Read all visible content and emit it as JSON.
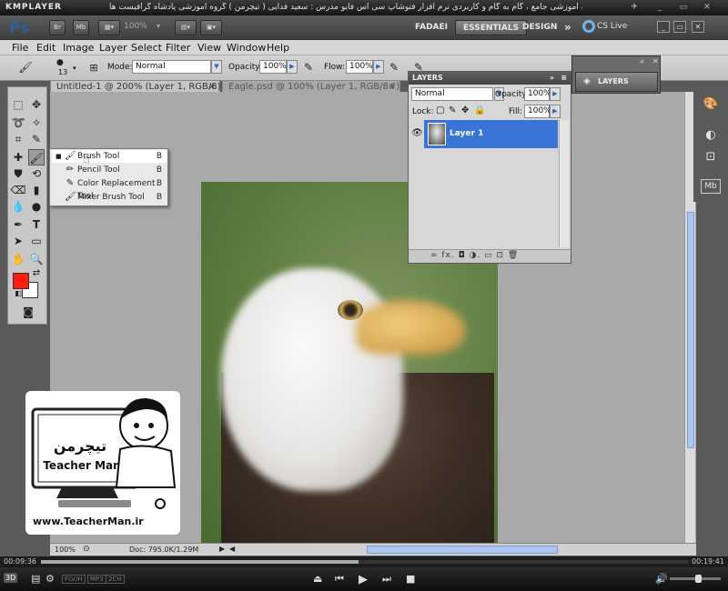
{
  "kmplayer": {
    "logo": "KMPLAYER",
    "title": "مجموعه آموزشی جامع ، گام به گام و کاربردی نرم افزار فتوشاپ سی اس فایو  مدرس : سعید فدایی ( تیچرمن ) گروه آموزشی پادشاه گرافیست ها",
    "time_elapsed": "00:09:36",
    "time_total": "00:19:41",
    "progress": 0.49,
    "badges": [
      "FLV/H",
      "MP3",
      "2CH"
    ],
    "mode_3d": "3D"
  },
  "appbar": {
    "ps_logo": "Ps",
    "br_label": "Br",
    "mb_label": "Mb",
    "zoom": "100%",
    "workspaces": [
      "FADAEI",
      "ESSENTIALS",
      "DESIGN"
    ],
    "more": "»",
    "cslive": "CS Live"
  },
  "menu": [
    "File",
    "Edit",
    "Image",
    "Layer",
    "Select",
    "Filter",
    "View",
    "Window",
    "Help"
  ],
  "options": {
    "brush_size": "13",
    "mode_label": "Mode:",
    "mode_value": "Normal",
    "opacity_label": "Opacity:",
    "opacity_value": "100%",
    "flow_label": "Flow:",
    "flow_value": "100%"
  },
  "tabs": [
    {
      "label": "Untitled-1 @ 200% (Layer 1, RGB/8) *",
      "close": "×"
    },
    {
      "label": "Eagle.psd @ 100% (Layer 1, RGB/8#) *",
      "close": "×"
    }
  ],
  "flyout": [
    {
      "label": "Brush Tool",
      "key": "B",
      "icon": "brush-icon",
      "selected": true
    },
    {
      "label": "Pencil Tool",
      "key": "B",
      "icon": "pencil-icon",
      "selected": false
    },
    {
      "label": "Color Replacement Tool",
      "key": "B",
      "icon": "color-replacement-icon",
      "selected": false
    },
    {
      "label": "Mixer Brush Tool",
      "key": "B",
      "icon": "mixer-brush-icon",
      "selected": false
    }
  ],
  "layers_panel": {
    "title": "LAYERS",
    "blend": "Normal",
    "opacity_label": "Opacity:",
    "opacity_value": "100%",
    "lock_label": "Lock:",
    "fill_label": "Fill:",
    "fill_value": "100%",
    "layer_name": "Layer 1",
    "footer_icons": "∞  fx.  ◘  ◑.  ▭  ⊡  🗑"
  },
  "collapsed_panel": {
    "label": "LAYERS"
  },
  "status": {
    "zoom": "100%",
    "doc": "Doc: 795.0K/1.29M"
  },
  "logo": {
    "url": "www.TeacherMan.ir",
    "brand": "Teacher Man",
    "brand_fa": "تیچرمن"
  },
  "colors": {
    "foreground": "#ff1b0f",
    "background": "#ffffff",
    "selection": "#3875d7"
  }
}
